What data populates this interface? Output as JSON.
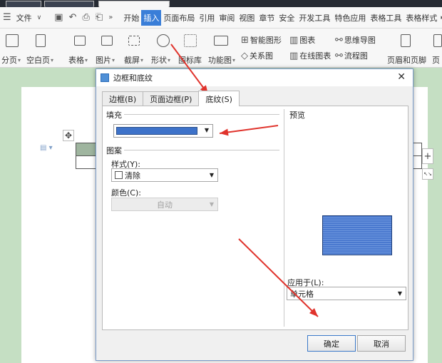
{
  "menubar": {
    "file_label": "文件",
    "items": [
      "开始",
      "插入",
      "页面布局",
      "引用",
      "审阅",
      "视图",
      "章节",
      "安全",
      "开发工具",
      "特色应用",
      "表格工具",
      "表格样式"
    ],
    "active_item": "插入",
    "search_glyph": "Q"
  },
  "ribbon": {
    "fenye": "分页",
    "kongbaiye": "空白页",
    "biaoge": "表格",
    "tupian": "图片",
    "jieping": "截屏",
    "xingzhuang": "形状",
    "tubiaoku": "图标库",
    "gongnengtu": "功能图",
    "zhineng_tuxing": "智能图形",
    "tubiao": "图表",
    "siwei_daotu": "思维导图",
    "guanxitu": "关系图",
    "zaixian_tubiao": "在线图表",
    "liuchengtu": "流程图",
    "yemei_yejiao": "页眉和页脚",
    "ye_partial": "页"
  },
  "dialog": {
    "title": "边框和底纹",
    "tabs": [
      {
        "label": "边框(B)",
        "active": false
      },
      {
        "label": "页面边框(P)",
        "active": false
      },
      {
        "label": "底纹(S)",
        "active": true
      }
    ],
    "fill_label": "填充",
    "fill_color": "#3d72c9",
    "pattern_label": "图案",
    "style_label": "样式(Y):",
    "style_value": "清除",
    "color_label": "颜色(C):",
    "color_value": "自动",
    "preview_label": "预览",
    "apply_label": "应用于(L):",
    "apply_value": "单元格",
    "ok_label": "确定",
    "cancel_label": "取消",
    "close_glyph": "✕"
  },
  "side": {
    "plus": "+",
    "expand": "↖↘"
  },
  "annotation_color": "#e0332c"
}
